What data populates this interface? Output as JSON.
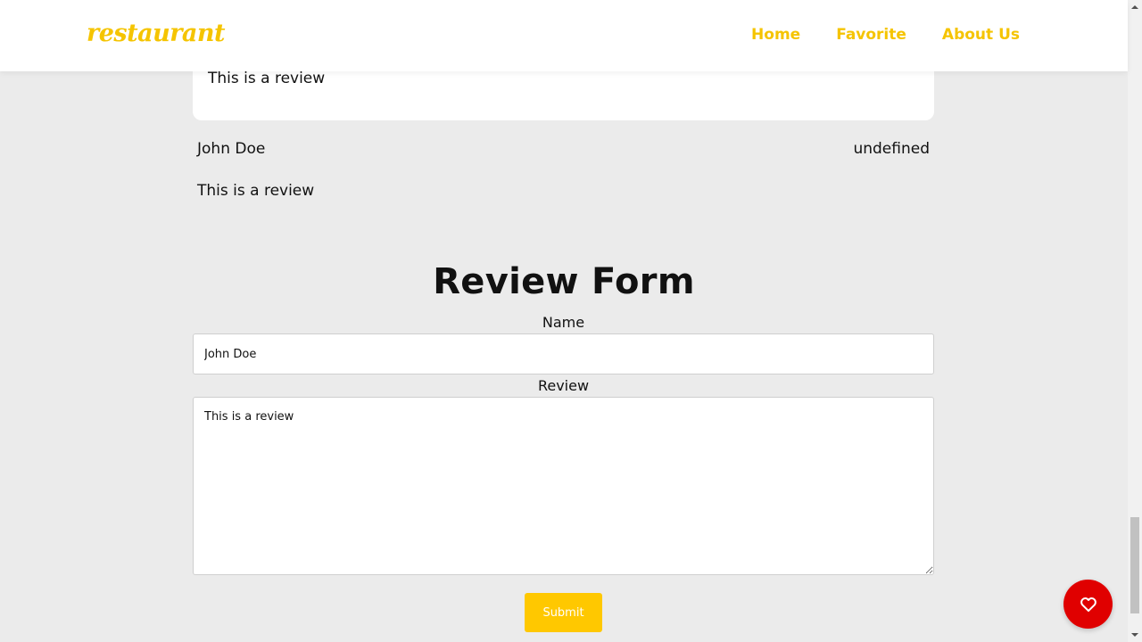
{
  "nav": {
    "logo": "restaurant",
    "links": [
      "Home",
      "Favorite",
      "About Us"
    ]
  },
  "reviews": [
    {
      "text": "This is a review"
    },
    {
      "name": "John Doe",
      "date": "undefined",
      "text": "This is a review"
    }
  ],
  "form": {
    "title": "Review Form",
    "name_label": "Name",
    "name_value": "John Doe",
    "review_label": "Review",
    "review_value": "This is a review",
    "submit_label": "Submit"
  },
  "colors": {
    "brand": "#f5c400",
    "button": "#ffc800",
    "favorite_fab": "#e00000",
    "background": "#ebebeb"
  },
  "icons": {
    "favorite_fab": "heart-icon"
  }
}
